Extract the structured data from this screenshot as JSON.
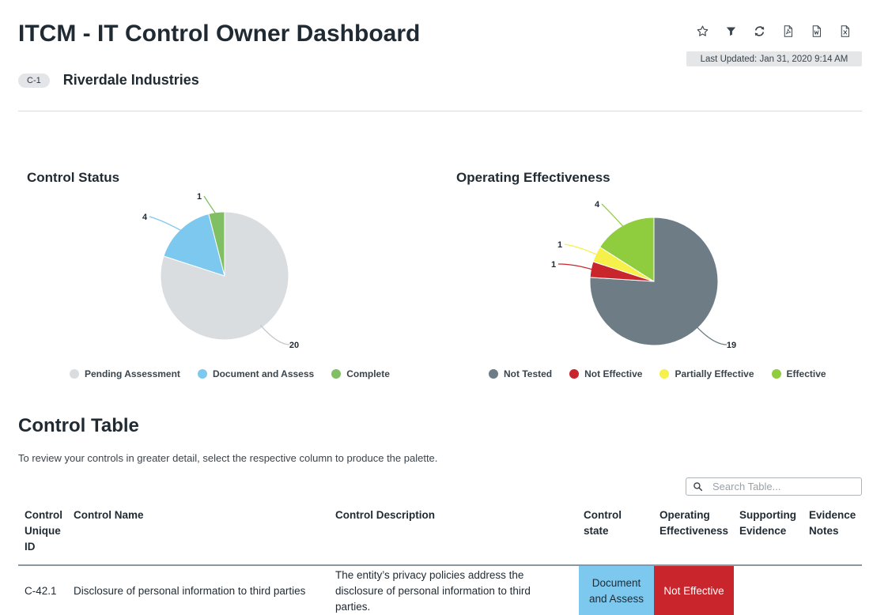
{
  "header": {
    "title": "ITCM - IT Control Owner Dashboard",
    "last_updated": "Last Updated: Jan 31, 2020 9:14 AM",
    "badge": "C-1",
    "org_name": "Riverdale Industries",
    "toolbar_icons": [
      "star-icon",
      "filter-icon",
      "refresh-icon",
      "pdf-icon",
      "word-icon",
      "excel-icon"
    ]
  },
  "chart_data": [
    {
      "type": "pie",
      "title": "Control Status",
      "categories": [
        "Pending Assessment",
        "Document and Assess",
        "Complete"
      ],
      "values": [
        20,
        4,
        1
      ],
      "colors": [
        "#dadde0",
        "#7cc8ee",
        "#80bf63"
      ],
      "legend": "bottom"
    },
    {
      "type": "pie",
      "title": "Operating Effectiveness",
      "categories": [
        "Not Tested",
        "Not Effective",
        "Partially Effective",
        "Effective"
      ],
      "values": [
        19,
        1,
        1,
        4
      ],
      "colors": [
        "#6e7d85",
        "#c8262c",
        "#f6f04a",
        "#8fcc3e"
      ],
      "legend": "bottom"
    }
  ],
  "table": {
    "title": "Control Table",
    "hint": "To review your controls in greater detail, select the respective column to produce the palette.",
    "search_placeholder": "Search Table...",
    "headers": {
      "id": [
        "Control",
        "Unique",
        "ID"
      ],
      "name": "Control Name",
      "description": "Control Description",
      "state": [
        "Control",
        "state"
      ],
      "effectiveness": [
        "Operating",
        "Effectiveness"
      ],
      "evidence": [
        "Supporting",
        "Evidence"
      ],
      "notes": [
        "Evidence",
        "Notes"
      ]
    },
    "rows": [
      {
        "id": "C-42.1",
        "name": "Disclosure of personal information to third parties",
        "description": [
          "The entity’s privacy policies address the",
          "disclosure of personal information to third",
          "parties."
        ],
        "state": [
          "Document",
          "and Assess"
        ],
        "state_color": "#7cc8ee",
        "effectiveness": "Not Effective",
        "effectiveness_color": "#c8262c"
      }
    ]
  }
}
